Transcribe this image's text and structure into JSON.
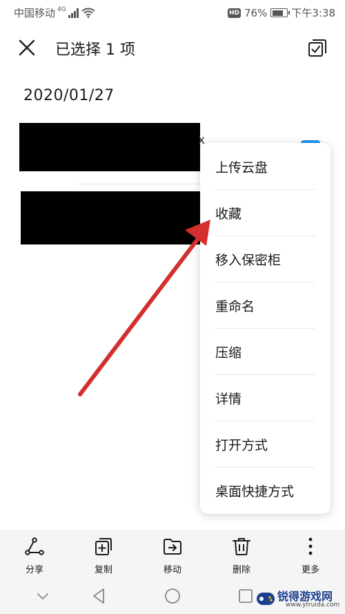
{
  "status_bar": {
    "carrier": "中国移动",
    "network_tag": "4G",
    "battery_text": "76%",
    "battery_level": 0.76,
    "time": "下午3:38",
    "hd_label": "HD"
  },
  "header": {
    "title": "已选择 1 项"
  },
  "file_list": {
    "date_group": "2020/01/27",
    "item_1_partial_text": "x"
  },
  "popup_menu": {
    "items": [
      {
        "label": "上传云盘"
      },
      {
        "label": "收藏"
      },
      {
        "label": "移入保密柜"
      },
      {
        "label": "重命名"
      },
      {
        "label": "压缩"
      },
      {
        "label": "详情"
      },
      {
        "label": "打开方式"
      },
      {
        "label": "桌面快捷方式"
      }
    ]
  },
  "toolbar": {
    "share_label": "分享",
    "copy_label": "复制",
    "move_label": "移动",
    "delete_label": "删除",
    "more_label": "更多"
  },
  "watermark": {
    "title": "锐得游戏网",
    "url": "www.ytruida.com"
  },
  "colors": {
    "accent_blue": "#2196f3",
    "annotation_red": "#d32f2f",
    "toolbar_bg": "#f5f5f5"
  },
  "icons": {
    "close": "close-icon",
    "select_all": "select-all-icon",
    "share": "share-icon",
    "copy": "copy-icon",
    "move": "move-icon",
    "delete": "delete-icon",
    "more": "more-icon"
  }
}
